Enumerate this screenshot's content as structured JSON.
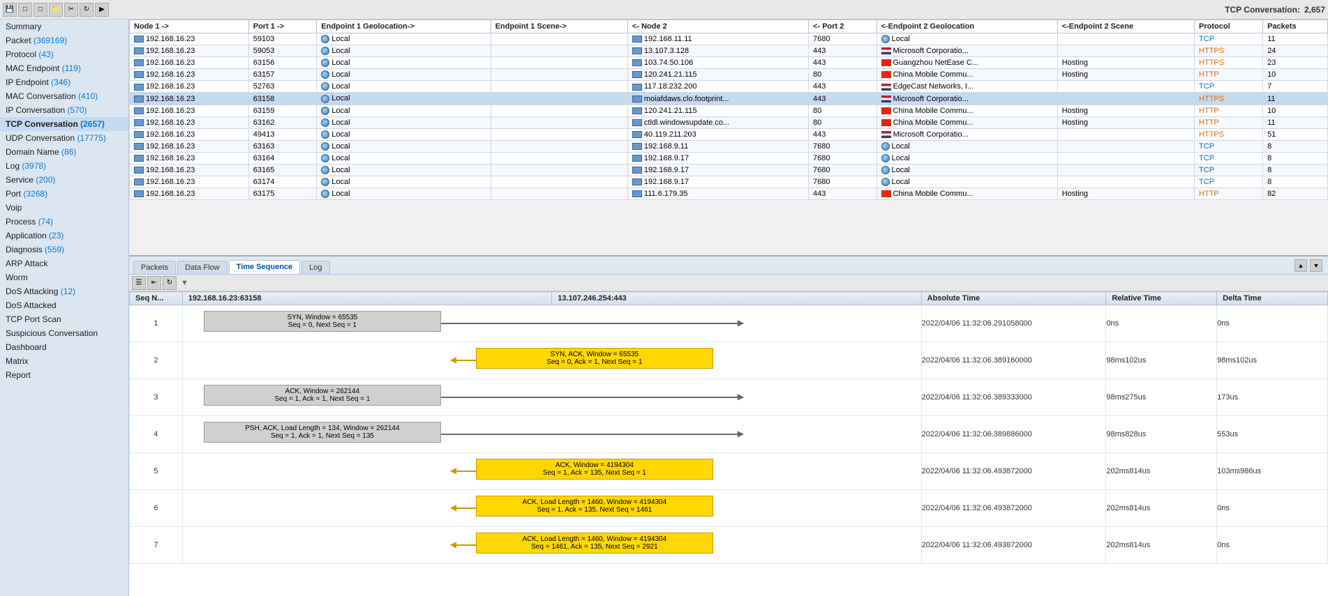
{
  "toolbar": {
    "tcp_conversation_label": "TCP Conversation:",
    "tcp_conversation_count": "2,657"
  },
  "sidebar": {
    "items": [
      {
        "id": "summary",
        "label": "Summary",
        "count": null
      },
      {
        "id": "packet",
        "label": "Packet",
        "count": "(369169)"
      },
      {
        "id": "protocol",
        "label": "Protocol",
        "count": "(43)"
      },
      {
        "id": "mac-endpoint",
        "label": "MAC Endpoint",
        "count": "(119)"
      },
      {
        "id": "ip-endpoint",
        "label": "IP Endpoint",
        "count": "(346)"
      },
      {
        "id": "mac-conversation",
        "label": "MAC Conversation",
        "count": "(410)"
      },
      {
        "id": "ip-conversation",
        "label": "IP Conversation",
        "count": "(570)"
      },
      {
        "id": "tcp-conversation",
        "label": "TCP Conversation",
        "count": "(2657)",
        "active": true
      },
      {
        "id": "udp-conversation",
        "label": "UDP Conversation",
        "count": "(17775)"
      },
      {
        "id": "domain-name",
        "label": "Domain Name",
        "count": "(86)"
      },
      {
        "id": "log",
        "label": "Log",
        "count": "(3978)"
      },
      {
        "id": "service",
        "label": "Service",
        "count": "(200)"
      },
      {
        "id": "port",
        "label": "Port",
        "count": "(3268)"
      },
      {
        "id": "voip",
        "label": "Voip",
        "count": null
      },
      {
        "id": "process",
        "label": "Process",
        "count": "(74)"
      },
      {
        "id": "application",
        "label": "Application",
        "count": "(23)"
      },
      {
        "id": "diagnosis",
        "label": "Diagnosis",
        "count": "(559)"
      },
      {
        "id": "arp-attack",
        "label": "ARP Attack",
        "count": null
      },
      {
        "id": "worm",
        "label": "Worm",
        "count": null
      },
      {
        "id": "dos-attacking",
        "label": "DoS Attacking",
        "count": "(12)"
      },
      {
        "id": "dos-attacked",
        "label": "DoS Attacked",
        "count": null
      },
      {
        "id": "tcp-port-scan",
        "label": "TCP Port Scan",
        "count": null
      },
      {
        "id": "suspicious-conversation",
        "label": "Suspicious Conversation",
        "count": null
      },
      {
        "id": "dashboard",
        "label": "Dashboard",
        "count": null
      },
      {
        "id": "matrix",
        "label": "Matrix",
        "count": null
      },
      {
        "id": "report",
        "label": "Report",
        "count": null
      }
    ]
  },
  "table": {
    "columns": [
      "Node 1 ->",
      "Port 1 ->",
      "Endpoint 1 Geolocation->",
      "Endpoint 1 Scene->",
      "<- Node 2",
      "<- Port 2",
      "<-Endpoint 2 Geolocation",
      "<-Endpoint 2 Scene",
      "Protocol",
      "Packets"
    ],
    "rows": [
      {
        "node1": "192.168.16.23",
        "port1": "59103",
        "geo1": "Local",
        "scene1": "",
        "node2": "192.168.11.11",
        "port2": "7680",
        "geo2": "Local",
        "scene2": "",
        "protocol": "TCP",
        "packets": "11",
        "flag2": "none"
      },
      {
        "node1": "192.168.16.23",
        "port1": "59053",
        "geo1": "Local",
        "scene1": "",
        "node2": "13.107.3.128",
        "port2": "443",
        "geo2": "Microsoft Corporatio...",
        "scene2": "",
        "protocol": "HTTPS",
        "packets": "24",
        "flag2": "us"
      },
      {
        "node1": "192.168.16.23",
        "port1": "63156",
        "geo1": "Local",
        "scene1": "",
        "node2": "103.74.50.106",
        "port2": "443",
        "geo2": "Guangzhou NetEase C...",
        "scene2": "Hosting",
        "protocol": "HTTPS",
        "packets": "23",
        "flag2": "cn"
      },
      {
        "node1": "192.168.16.23",
        "port1": "63157",
        "geo1": "Local",
        "scene1": "",
        "node2": "120.241.21.115",
        "port2": "80",
        "geo2": "China Mobile Commu...",
        "scene2": "Hosting",
        "protocol": "HTTP",
        "packets": "10",
        "flag2": "cn"
      },
      {
        "node1": "192.168.16.23",
        "port1": "52763",
        "geo1": "Local",
        "scene1": "",
        "node2": "117.18.232.200",
        "port2": "443",
        "geo2": "EdgeCast Networks, I...",
        "scene2": "",
        "protocol": "TCP",
        "packets": "7",
        "flag2": "us"
      },
      {
        "node1": "192.168.16.23",
        "port1": "63158",
        "geo1": "Local",
        "scene1": "",
        "node2": "moiafdaws.clo.footprint...",
        "port2": "443",
        "geo2": "Microsoft Corporatio...",
        "scene2": "",
        "protocol": "HTTPS",
        "packets": "11",
        "flag2": "us",
        "highlight": true
      },
      {
        "node1": "192.168.16.23",
        "port1": "63159",
        "geo1": "Local",
        "scene1": "",
        "node2": "120.241.21.115",
        "port2": "80",
        "geo2": "China Mobile Commu...",
        "scene2": "Hosting",
        "protocol": "HTTP",
        "packets": "10",
        "flag2": "cn"
      },
      {
        "node1": "192.168.16.23",
        "port1": "63162",
        "geo1": "Local",
        "scene1": "",
        "node2": "ctldl.windowsupdate.co...",
        "port2": "80",
        "geo2": "China Mobile Commu...",
        "scene2": "Hosting",
        "protocol": "HTTP",
        "packets": "11",
        "flag2": "cn"
      },
      {
        "node1": "192.168.16.23",
        "port1": "49413",
        "geo1": "Local",
        "scene1": "",
        "node2": "40.119.211.203",
        "port2": "443",
        "geo2": "Microsoft Corporatio...",
        "scene2": "",
        "protocol": "HTTPS",
        "packets": "51",
        "flag2": "us"
      },
      {
        "node1": "192.168.16.23",
        "port1": "63163",
        "geo1": "Local",
        "scene1": "",
        "node2": "192.168.9.11",
        "port2": "7680",
        "geo2": "Local",
        "scene2": "",
        "protocol": "TCP",
        "packets": "8",
        "flag2": "none"
      },
      {
        "node1": "192.168.16.23",
        "port1": "63164",
        "geo1": "Local",
        "scene1": "",
        "node2": "192.168.9.17",
        "port2": "7680",
        "geo2": "Local",
        "scene2": "",
        "protocol": "TCP",
        "packets": "8",
        "flag2": "none"
      },
      {
        "node1": "192.168.16.23",
        "port1": "63165",
        "geo1": "Local",
        "scene1": "",
        "node2": "192.168.9.17",
        "port2": "7680",
        "geo2": "Local",
        "scene2": "",
        "protocol": "TCP",
        "packets": "8",
        "flag2": "none"
      },
      {
        "node1": "192.168.16.23",
        "port1": "63174",
        "geo1": "Local",
        "scene1": "",
        "node2": "192.168.9.17",
        "port2": "7680",
        "geo2": "Local",
        "scene2": "",
        "protocol": "TCP",
        "packets": "8",
        "flag2": "none"
      },
      {
        "node1": "192.168.16.23",
        "port1": "63175",
        "geo1": "Local",
        "scene1": "",
        "node2": "111.6.179.35",
        "port2": "443",
        "geo2": "China Mobile Commu...",
        "scene2": "Hosting",
        "protocol": "HTTP",
        "packets": "82",
        "flag2": "cn"
      }
    ]
  },
  "bottom_tabs": {
    "tabs": [
      "Packets",
      "Data Flow",
      "Time Sequence",
      "Log"
    ],
    "active": "Time Sequence"
  },
  "time_sequence": {
    "node1": "192.168.16.23:63158",
    "node2": "13.107.246.254:443",
    "col_abs": "Absolute Time",
    "col_rel": "Relative Time",
    "col_delta": "Delta Time",
    "col_seq": "Seq N...",
    "rows": [
      {
        "seq": "1",
        "direction": "right",
        "content_line1": "SYN, Window = 65535",
        "content_line2": "Seq = 0, Next Seq = 1",
        "abs_time": "2022/04/06 11:32:06.291058000",
        "rel_time": "0ns",
        "delta_time": "0ns",
        "box_style": "gray"
      },
      {
        "seq": "2",
        "direction": "left",
        "content_line1": "SYN, ACK, Window = 65535",
        "content_line2": "Seq = 0, Ack = 1, Next Seq = 1",
        "abs_time": "2022/04/06 11:32:06.389160000",
        "rel_time": "98ms102us",
        "delta_time": "98ms102us",
        "box_style": "yellow"
      },
      {
        "seq": "3",
        "direction": "right",
        "content_line1": "ACK, Window = 262144",
        "content_line2": "Seq = 1, Ack = 1, Next Seq = 1",
        "abs_time": "2022/04/06 11:32:06.389333000",
        "rel_time": "98ms275us",
        "delta_time": "173us",
        "box_style": "gray"
      },
      {
        "seq": "4",
        "direction": "right",
        "content_line1": "PSH, ACK, Load Length = 134, Window = 262144",
        "content_line2": "Seq = 1, Ack = 1, Next Seq = 135",
        "abs_time": "2022/04/06 11:32:06.389886000",
        "rel_time": "98ms828us",
        "delta_time": "553us",
        "box_style": "gray"
      },
      {
        "seq": "5",
        "direction": "left",
        "content_line1": "ACK, Window = 4194304",
        "content_line2": "Seq = 1, Ack = 135, Next Seq = 1",
        "abs_time": "2022/04/06 11:32:06.493872000",
        "rel_time": "202ms814us",
        "delta_time": "103ms986us",
        "box_style": "yellow"
      },
      {
        "seq": "6",
        "direction": "left",
        "content_line1": "ACK, Load Length = 1460, Window = 4194304",
        "content_line2": "Seq = 1, Ack = 135, Next Seq = 1461",
        "abs_time": "2022/04/06 11:32:06.493872000",
        "rel_time": "202ms814us",
        "delta_time": "0ns",
        "box_style": "yellow"
      },
      {
        "seq": "7",
        "direction": "left",
        "content_line1": "ACK, Load Length = 1460, Window = 4194304",
        "content_line2": "Seq = 1461, Ack = 135, Next Seq = 2921",
        "abs_time": "2022/04/06 11:32:06.493872000",
        "rel_time": "202ms814us",
        "delta_time": "0ns",
        "box_style": "yellow"
      }
    ]
  }
}
